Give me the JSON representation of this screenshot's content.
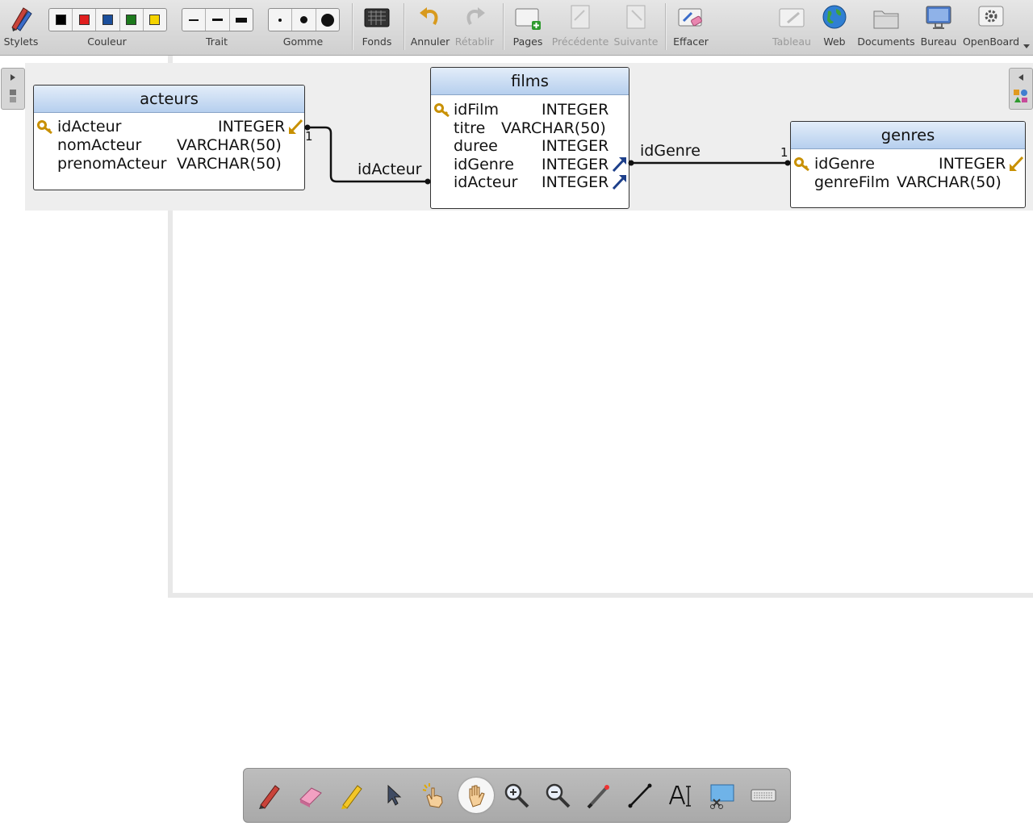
{
  "toolbar": {
    "stylets": "Stylets",
    "couleur": "Couleur",
    "trait": "Trait",
    "gomme": "Gomme",
    "fonds": "Fonds",
    "annuler": "Annuler",
    "retablir": "Rétablir",
    "pages": "Pages",
    "precedente": "Précédente",
    "suivante": "Suivante",
    "effacer": "Effacer",
    "tableau": "Tableau",
    "web": "Web",
    "documents": "Documents",
    "bureau": "Bureau",
    "openboard": "OpenBoard",
    "colors": [
      "#000000",
      "#e01e1e",
      "#1b4f9c",
      "#1d7a1d",
      "#f5d400"
    ],
    "disabled": [
      "retablir",
      "precedente",
      "suivante",
      "tableau"
    ]
  },
  "diagram": {
    "tables": [
      {
        "id": "acteurs",
        "title": "acteurs",
        "fields": [
          {
            "name": "idActeur",
            "type": "INTEGER",
            "pk": true
          },
          {
            "name": "nomActeur",
            "type": "VARCHAR(50)"
          },
          {
            "name": "prenomActeur",
            "type": "VARCHAR(50)"
          }
        ]
      },
      {
        "id": "films",
        "title": "films",
        "fields": [
          {
            "name": "idFilm",
            "type": "INTEGER",
            "pk": true
          },
          {
            "name": "titre",
            "type": "VARCHAR(50)"
          },
          {
            "name": "duree",
            "type": "INTEGER"
          },
          {
            "name": "idGenre",
            "type": "INTEGER"
          },
          {
            "name": "idActeur",
            "type": "INTEGER"
          }
        ]
      },
      {
        "id": "genres",
        "title": "genres",
        "fields": [
          {
            "name": "idGenre",
            "type": "INTEGER",
            "pk": true
          },
          {
            "name": "genreFilm",
            "type": "VARCHAR(50)"
          }
        ]
      }
    ],
    "links": [
      {
        "label": "idActeur",
        "cardinality": "1"
      },
      {
        "label": "idGenre",
        "cardinality": "1"
      }
    ]
  },
  "bottom_tools": [
    "pen",
    "eraser",
    "highlighter",
    "selector",
    "interact",
    "hand",
    "zoom-in",
    "zoom-out",
    "laser-pointer",
    "line",
    "text",
    "capture",
    "keyboard"
  ],
  "active_tool": "hand"
}
